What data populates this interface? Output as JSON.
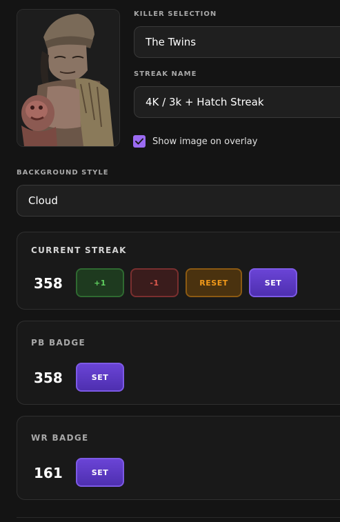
{
  "killer": {
    "label": "KILLER SELECTION",
    "value": "The Twins",
    "portrait_icon": "killer-portrait-image"
  },
  "streak_name": {
    "label": "STREAK NAME",
    "value": "4K / 3k + Hatch Streak"
  },
  "overlay_option": {
    "label": "Show image on overlay",
    "checked": true,
    "check_color": "#9b6bf2"
  },
  "background_style": {
    "label": "BACKGROUND STYLE",
    "value": "Cloud"
  },
  "current_streak": {
    "title": "CURRENT STREAK",
    "count": "358",
    "buttons": {
      "plus": "+1",
      "minus": "-1",
      "reset": "RESET",
      "set": "SET"
    }
  },
  "pb_badge": {
    "title": "PB BADGE",
    "count": "358",
    "set": "SET"
  },
  "wr_badge": {
    "title": "WR BADGE",
    "count": "161",
    "set": "SET"
  },
  "colors": {
    "accent": "#6a44d6",
    "positive": "#5fcf5f",
    "negative": "#e05a4f",
    "warning": "#f29a1a"
  }
}
